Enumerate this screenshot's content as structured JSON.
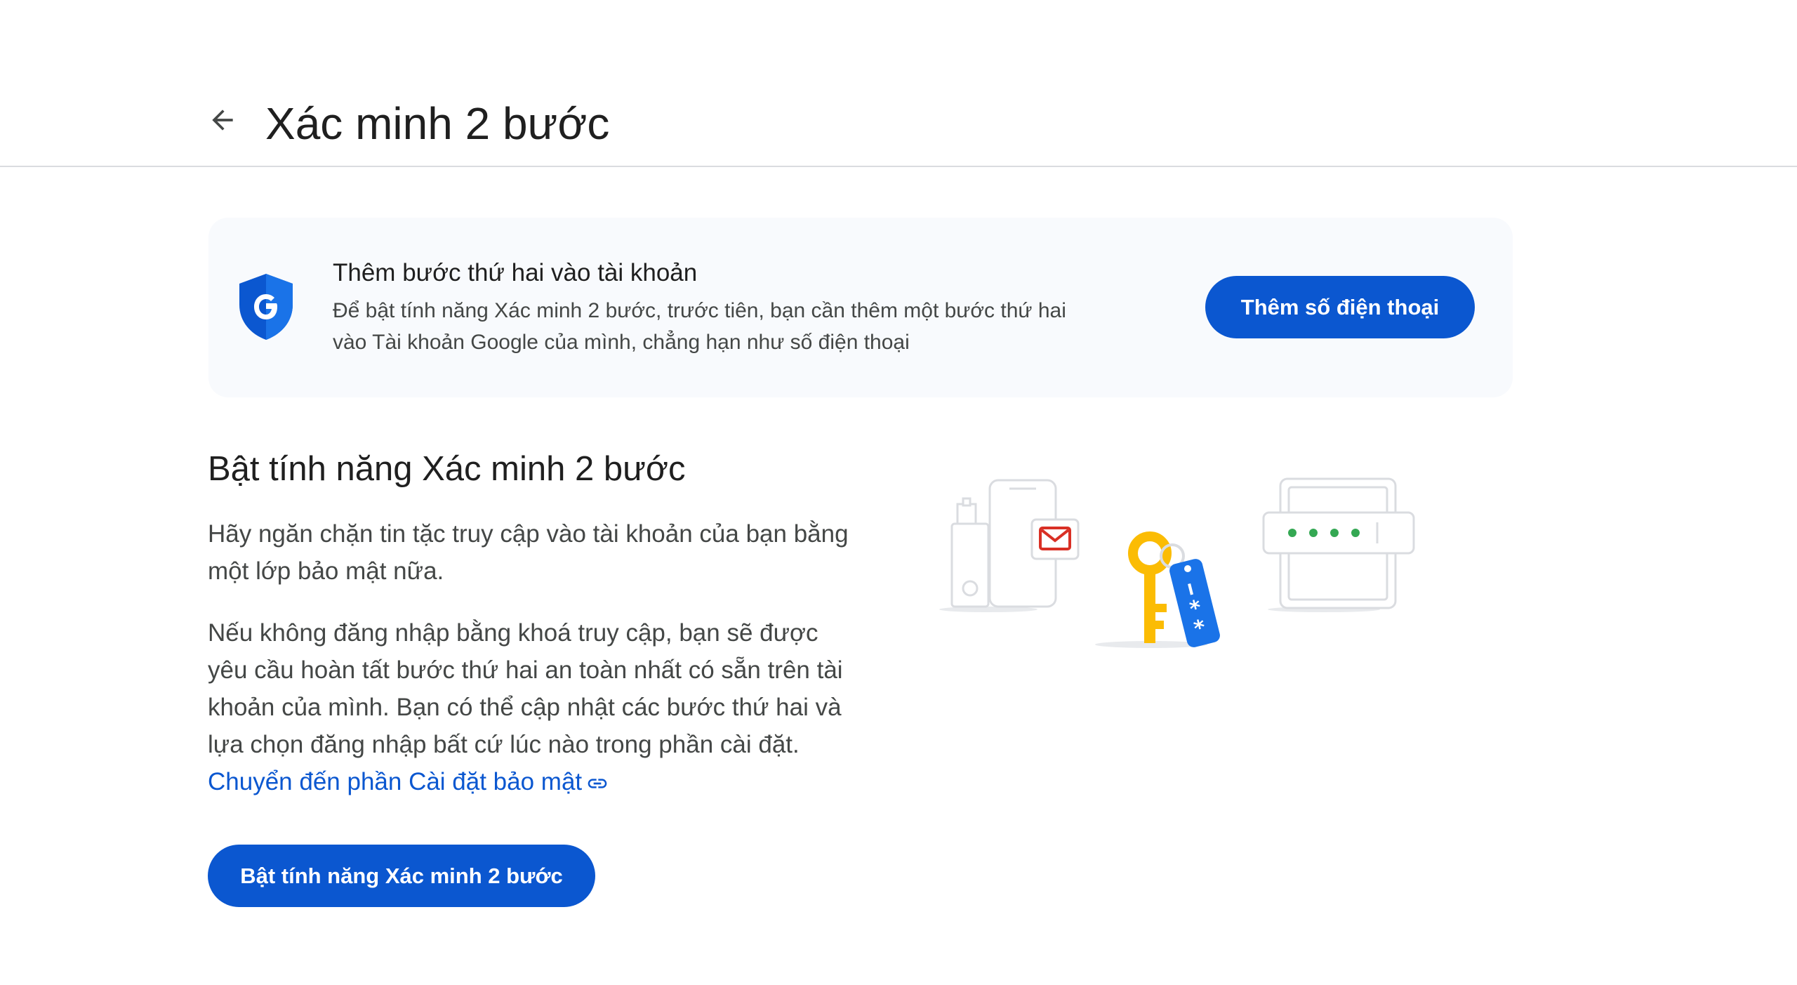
{
  "header": {
    "title": "Xác minh 2 bước"
  },
  "icons": {
    "back": "arrow-left-icon",
    "shield": "google-shield-icon",
    "link": "link-icon"
  },
  "banner": {
    "title": "Thêm bước thứ hai vào tài khoản",
    "description": "Để bật tính năng Xác minh 2 bước, trước tiên, bạn cần thêm một bước thứ hai vào Tài khoản Google của mình, chẳng hạn như số điện thoại",
    "button_label": "Thêm số điện thoại"
  },
  "section": {
    "title": "Bật tính năng Xác minh 2 bước",
    "paragraph1": "Hãy ngăn chặn tin tặc truy cập vào tài khoản của bạn bằng một lớp bảo mật nữa.",
    "paragraph2": "Nếu không đăng nhập bằng khoá truy cập, bạn sẽ được yêu cầu hoàn tất bước thứ hai an toàn nhất có sẵn trên tài khoản của mình. Bạn có thể cập nhật các bước thứ hai và lựa chọn đăng nhập bất cứ lúc nào trong phần cài đặt.",
    "link_label": "Chuyển đến phần Cài đặt bảo mật",
    "button_label": "Bật tính năng Xác minh 2 bước"
  },
  "colors": {
    "accent": "#0b57d0",
    "banner_bg": "#f8fafd",
    "key_yellow": "#fbbc04",
    "mail_red": "#d93025",
    "dots_green": "#34a853"
  }
}
